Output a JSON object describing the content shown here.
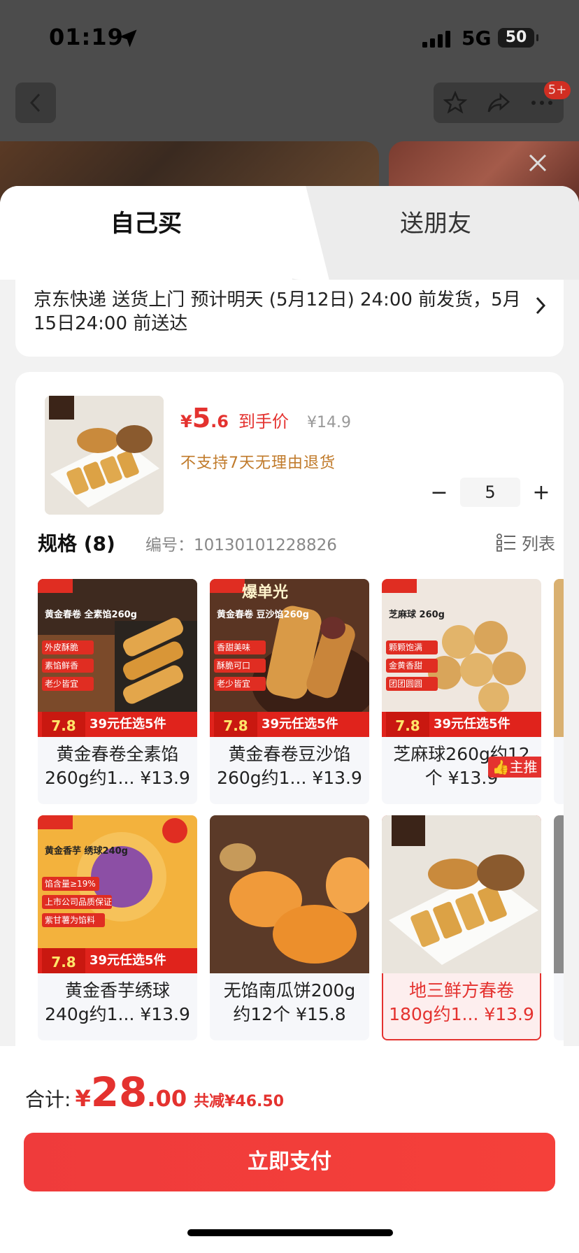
{
  "status_bar": {
    "time": "01:19",
    "network": "5G",
    "battery": "50"
  },
  "nav": {
    "notification_badge": "5+"
  },
  "tabs": [
    {
      "label": "自己买",
      "active": true
    },
    {
      "label": "送朋友",
      "active": false
    }
  ],
  "shipping": {
    "text": "京东快递 送货上门 预计明天 (5月12日) 24:00 前发货，5月15日24:00 前送达"
  },
  "product": {
    "price_currency": "¥",
    "price_int": "5",
    "price_dec": ".6",
    "price_tag": "到手价",
    "original_price": "¥14.9",
    "no_return": "不支持7天无理由退货",
    "quantity": "5",
    "minus": "−",
    "plus": "+"
  },
  "spec": {
    "title": "规格 (8)",
    "number": "编号：10130101228826",
    "list_label": "列表"
  },
  "variants": [
    {
      "caption": "黄金春卷全素馅260g约1... ¥13.9",
      "overlay_title": "黄金春卷 全素馅260g",
      "tags": [
        "外皮酥脆",
        "素馅鲜香",
        "老少皆宜"
      ],
      "promo_price": "7.8",
      "promo_text": "39元任选5件",
      "selected": false
    },
    {
      "caption": "黄金春卷豆沙馅260g约1... ¥13.9",
      "overlay_title": "黄金春卷 豆沙馅260g",
      "hot_text": "爆单光",
      "tags": [
        "香甜美味",
        "酥脆可口",
        "老少皆宜"
      ],
      "promo_price": "7.8",
      "promo_text": "39元任选5件",
      "selected": false
    },
    {
      "caption": "芝麻球260g约12个 ¥13.9",
      "overlay_title": "芝麻球 260g",
      "tags": [
        "颗颗饱满",
        "金黄香甜",
        "团团圆圆"
      ],
      "promo_price": "7.8",
      "promo_text": "39元任选5件",
      "selected": false
    },
    {
      "caption": "黄金香芋绣球240g约1... ¥13.9",
      "overlay_title": "黄金香芋 绣球240g",
      "tags": [
        "馅含量≥19%",
        "上市公司品质保证",
        "紫甘薯为馅料"
      ],
      "promo_price": "7.8",
      "promo_text": "39元任选5件",
      "selected": false
    },
    {
      "caption": "无馅南瓜饼200g约12个 ¥15.8",
      "selected": false
    },
    {
      "caption": "地三鲜方春卷180g约1... ¥13.9",
      "selected": true
    }
  ],
  "main_push_label": "主推",
  "footer": {
    "total_label": "合计:",
    "total_currency": "¥",
    "total_int": "28",
    "total_dec": ".00",
    "savings": "共减¥46.50",
    "pay_label": "立即支付"
  },
  "colors": {
    "accent": "#e4322f",
    "warning": "#c07a2a"
  }
}
